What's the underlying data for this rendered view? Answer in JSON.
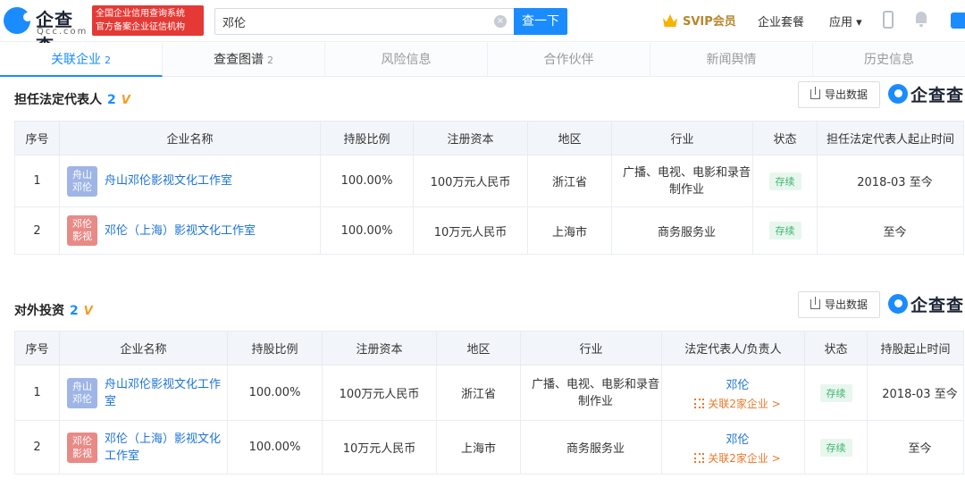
{
  "header": {
    "logo_text": "企查查",
    "logo_domain": "Qcc.com",
    "credit_line1": "全国企业信用查询系统",
    "credit_line2": "官方备案企业征信机构",
    "search_value": "邓伦",
    "search_button": "查一下",
    "svip": "SVIP会员",
    "nav_package": "企业套餐",
    "nav_apps": "应用 ▾"
  },
  "tabs": [
    {
      "label": "关联企业",
      "count": "2"
    },
    {
      "label": "查查图谱",
      "count": "2"
    },
    {
      "label": "风险信息",
      "count": ""
    },
    {
      "label": "合作伙伴",
      "count": ""
    },
    {
      "label": "新闻舆情",
      "count": ""
    },
    {
      "label": "历史信息",
      "count": ""
    }
  ],
  "section1": {
    "title": "担任法定代表人",
    "count": "2",
    "export_label": "导出数据",
    "brand": "企查查",
    "columns": [
      "序号",
      "企业名称",
      "持股比例",
      "注册资本",
      "地区",
      "行业",
      "状态",
      "担任法定代表人起止时间"
    ],
    "rows": [
      {
        "no": "1",
        "logo_l1": "舟山",
        "logo_l2": "邓伦",
        "name": "舟山邓伦影视文化工作室",
        "share": "100.00%",
        "capital": "100万元人民币",
        "region": "浙江省",
        "industry": "广播、电视、电影和录音制作业",
        "status": "存续",
        "period": "2018-03 至今"
      },
      {
        "no": "2",
        "logo_l1": "邓伦",
        "logo_l2": "影视",
        "name": "邓伦（上海）影视文化工作室",
        "share": "100.00%",
        "capital": "10万元人民币",
        "region": "上海市",
        "industry": "商务服务业",
        "status": "存续",
        "period": "至今"
      }
    ]
  },
  "section2": {
    "title": "对外投资",
    "count": "2",
    "export_label": "导出数据",
    "brand": "企查查",
    "columns": [
      "序号",
      "企业名称",
      "持股比例",
      "注册资本",
      "地区",
      "行业",
      "法定代表人/负责人",
      "状态",
      "持股起止时间"
    ],
    "rows": [
      {
        "no": "1",
        "logo_l1": "舟山",
        "logo_l2": "邓伦",
        "name": "舟山邓伦影视文化工作室",
        "share": "100.00%",
        "capital": "100万元人民币",
        "region": "浙江省",
        "industry": "广播、电视、电影和录音制作业",
        "rep": "邓伦",
        "rel": "关联2家企业 >",
        "status": "存续",
        "period": "2018-03 至今"
      },
      {
        "no": "2",
        "logo_l1": "邓伦",
        "logo_l2": "影视",
        "name": "邓伦（上海）影视文化工作室",
        "share": "100.00%",
        "capital": "10万元人民币",
        "region": "上海市",
        "industry": "商务服务业",
        "rep": "邓伦",
        "rel": "关联2家企业 >",
        "status": "存续",
        "period": "至今"
      }
    ]
  },
  "colors": {
    "accent": "#1a8cff",
    "status_green": "#3bb56f",
    "warn_orange": "#e8792b",
    "badge_red": "#e53935"
  }
}
